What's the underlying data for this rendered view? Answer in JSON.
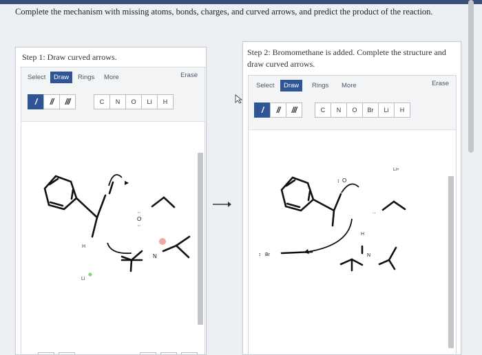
{
  "instructions": "Complete the mechanism with missing atoms, bonds, charges, and curved arrows, and predict the product of the reaction.",
  "colors": {
    "accent": "#2f5596",
    "header": "#3a4e75",
    "highlight": "#f4a5a5",
    "lithium_dot": "#7cd67c"
  },
  "step1": {
    "title": "Step 1: Draw curved arrows.",
    "tabs": {
      "select": "Select",
      "draw": "Draw",
      "rings": "Rings",
      "more": "More"
    },
    "erase": "Erase",
    "bonds": [
      "/",
      "//",
      "///"
    ],
    "atoms": [
      "C",
      "N",
      "O",
      "Li",
      "H"
    ],
    "labels": {
      "h": "H",
      "li": "Li",
      "n": "N",
      "o": "O"
    },
    "bottom_icons": [
      "undo-icon",
      "redo-icon",
      "zoom-in-icon",
      "reset-icon",
      "zoom-out-icon"
    ]
  },
  "step2": {
    "title": "Step 2: Bromomethane is added. Complete the structure and draw curved arrows.",
    "tabs": {
      "select": "Select",
      "draw": "Draw",
      "rings": "Rings",
      "more": "More"
    },
    "erase": "Erase",
    "bonds": [
      "/",
      "//",
      "///"
    ],
    "atoms": [
      "C",
      "N",
      "O",
      "Br",
      "Li",
      "H"
    ],
    "labels": {
      "o": "O",
      "br": "Br",
      "li": "Li+",
      "h": "H",
      "n": "N",
      "dots": ":"
    }
  }
}
